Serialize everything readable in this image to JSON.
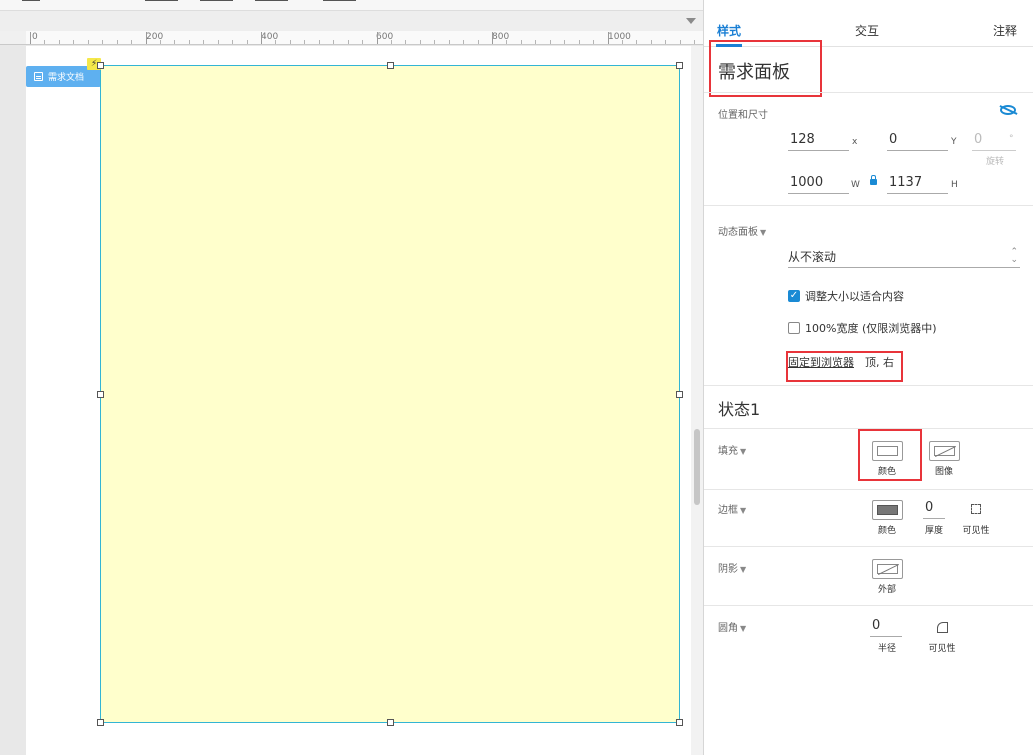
{
  "ruler": {
    "labels": [
      "0",
      "200",
      "400",
      "600",
      "800",
      "1000"
    ]
  },
  "canvas": {
    "doc_tag": "需求文档",
    "bolt_icon": "⚡"
  },
  "tabs": [
    {
      "label": "样式",
      "active": true
    },
    {
      "label": "交互",
      "active": false
    },
    {
      "label": "注释",
      "active": false
    }
  ],
  "widget": {
    "name": "需求面板"
  },
  "position_size": {
    "label": "位置和尺寸",
    "x": "128",
    "x_unit": "x",
    "y": "0",
    "y_unit": "Y",
    "rotation": "0",
    "rotation_unit": "°",
    "rotation_label": "旋转",
    "w": "1000",
    "w_unit": "W",
    "h": "1137",
    "h_unit": "H"
  },
  "dynamic_panel": {
    "label": "动态面板",
    "scroll_option": "从不滚动",
    "fit_content_label": "调整大小以适合内容",
    "fit_content_checked": true,
    "full_width_label": "100%宽度 (仅限浏览器中)",
    "full_width_checked": false,
    "pin_link": "固定到浏览器",
    "pin_value": "顶, 右"
  },
  "state": {
    "title": "状态1"
  },
  "fill": {
    "label": "填充",
    "color_label": "颜色",
    "image_label": "图像"
  },
  "border": {
    "label": "边框",
    "color_label": "颜色",
    "thickness": "0",
    "thickness_label": "厚度",
    "visibility_label": "可见性"
  },
  "shadow": {
    "label": "阴影",
    "outer_label": "外部"
  },
  "corner": {
    "label": "圆角",
    "radius": "0",
    "radius_label": "半径",
    "visibility_label": "可见性"
  },
  "colors": {
    "accent": "#1a7fd4",
    "panel_fill": "#ffffcc",
    "highlight": "#e8343a",
    "doc_tag": "#5eb0f0"
  },
  "icons": {
    "visibility": "eye-slash-icon",
    "lock": "lock-icon"
  }
}
